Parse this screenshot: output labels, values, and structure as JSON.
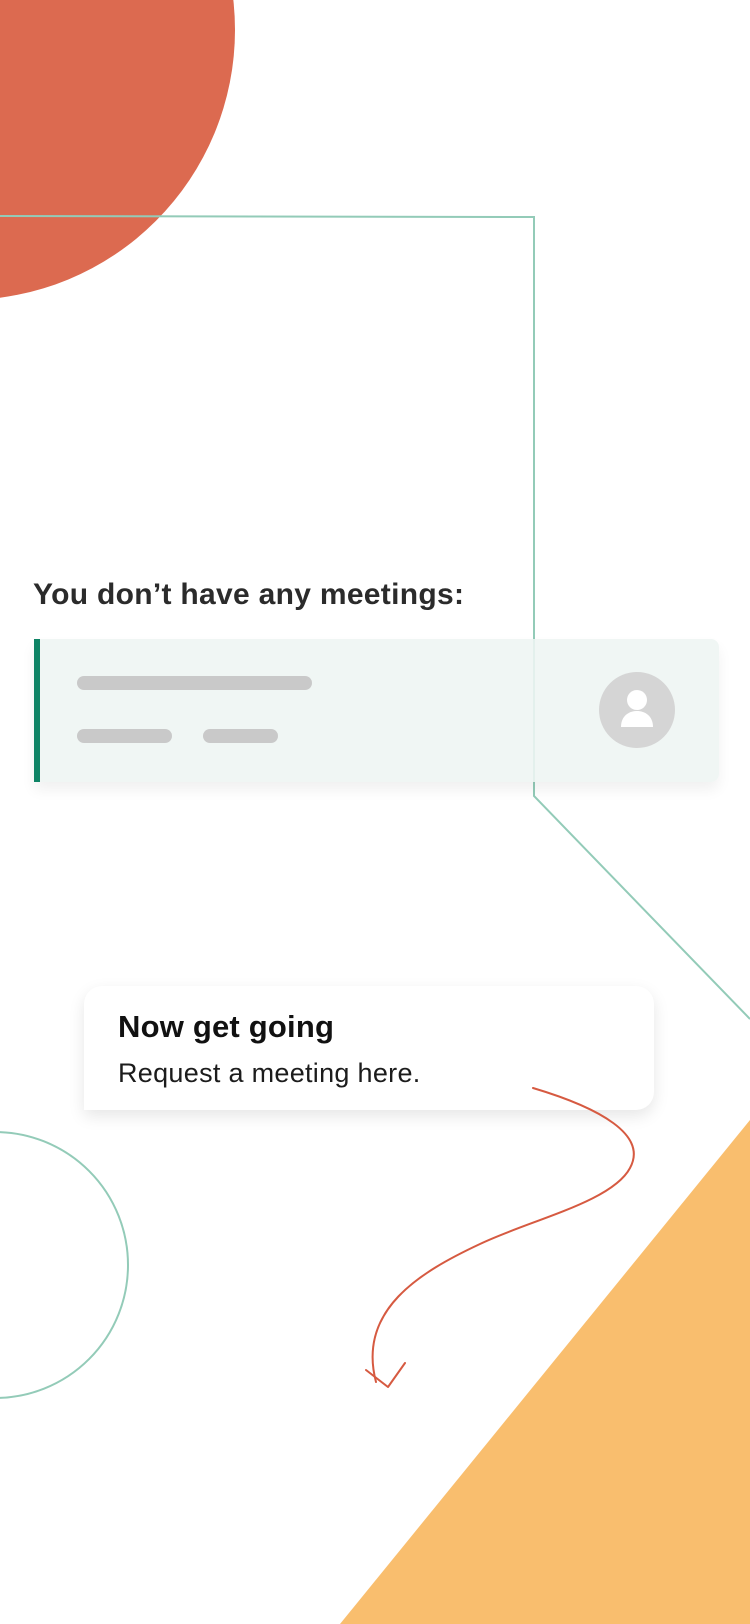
{
  "colors": {
    "accent_green": "#0f8466",
    "outline_green": "#93cbb8",
    "coral": "#dc6a50",
    "amber": "#f9be6e",
    "arrow_red": "#d65a41",
    "skeleton_gray": "#c9c9c9",
    "avatar_gray": "#d5d5d5",
    "card_tint": "#eef5f2"
  },
  "empty_state": {
    "heading": "You don’t have any meetings:",
    "placeholder_card": {
      "avatar_icon": "person-icon"
    }
  },
  "onboarding_tip": {
    "title": "Now get going",
    "body": "Request a meeting here.",
    "pointer_icon": "curved-arrow-down-icon"
  }
}
